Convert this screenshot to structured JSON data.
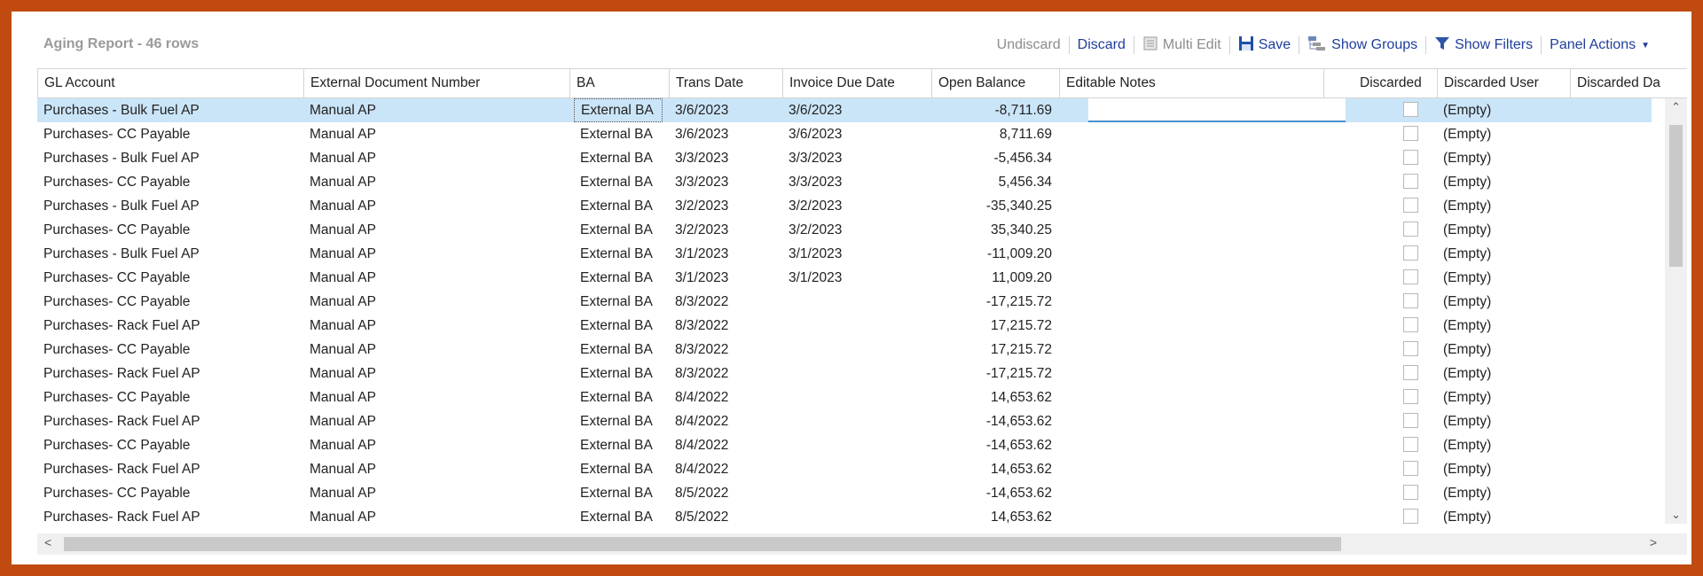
{
  "report_title": "Aging Report - 46 rows",
  "toolbar": {
    "undiscard": "Undiscard",
    "discard": "Discard",
    "multi_edit": "Multi Edit",
    "save": "Save",
    "show_groups": "Show Groups",
    "show_filters": "Show Filters",
    "panel_actions": "Panel Actions"
  },
  "columns": [
    "GL Account",
    "External Document Number",
    "BA",
    "Trans Date",
    "Invoice Due Date",
    "Open Balance",
    "Editable Notes",
    "Discarded",
    "Discarded User",
    "Discarded Da"
  ],
  "rows": [
    {
      "gl": "Purchases - Bulk Fuel AP",
      "doc": "Manual AP",
      "ba": "External BA",
      "trans": "3/6/2023",
      "due": "3/6/2023",
      "bal": "-8,711.69",
      "user": "(Empty)"
    },
    {
      "gl": "Purchases- CC Payable",
      "doc": "Manual AP",
      "ba": "External BA",
      "trans": "3/6/2023",
      "due": "3/6/2023",
      "bal": "8,711.69",
      "user": "(Empty)"
    },
    {
      "gl": "Purchases - Bulk Fuel AP",
      "doc": "Manual AP",
      "ba": "External BA",
      "trans": "3/3/2023",
      "due": "3/3/2023",
      "bal": "-5,456.34",
      "user": "(Empty)"
    },
    {
      "gl": "Purchases- CC Payable",
      "doc": "Manual AP",
      "ba": "External BA",
      "trans": "3/3/2023",
      "due": "3/3/2023",
      "bal": "5,456.34",
      "user": "(Empty)"
    },
    {
      "gl": "Purchases - Bulk Fuel AP",
      "doc": "Manual AP",
      "ba": "External BA",
      "trans": "3/2/2023",
      "due": "3/2/2023",
      "bal": "-35,340.25",
      "user": "(Empty)"
    },
    {
      "gl": "Purchases- CC Payable",
      "doc": "Manual AP",
      "ba": "External BA",
      "trans": "3/2/2023",
      "due": "3/2/2023",
      "bal": "35,340.25",
      "user": "(Empty)"
    },
    {
      "gl": "Purchases - Bulk Fuel AP",
      "doc": "Manual AP",
      "ba": "External BA",
      "trans": "3/1/2023",
      "due": "3/1/2023",
      "bal": "-11,009.20",
      "user": "(Empty)"
    },
    {
      "gl": "Purchases- CC Payable",
      "doc": "Manual AP",
      "ba": "External BA",
      "trans": "3/1/2023",
      "due": "3/1/2023",
      "bal": "11,009.20",
      "user": "(Empty)"
    },
    {
      "gl": "Purchases- CC Payable",
      "doc": "Manual AP",
      "ba": "External BA",
      "trans": "8/3/2022",
      "due": "",
      "bal": "-17,215.72",
      "user": "(Empty)"
    },
    {
      "gl": "Purchases- Rack Fuel AP",
      "doc": "Manual AP",
      "ba": "External BA",
      "trans": "8/3/2022",
      "due": "",
      "bal": "17,215.72",
      "user": "(Empty)"
    },
    {
      "gl": "Purchases- CC Payable",
      "doc": "Manual AP",
      "ba": "External BA",
      "trans": "8/3/2022",
      "due": "",
      "bal": "17,215.72",
      "user": "(Empty)"
    },
    {
      "gl": "Purchases- Rack Fuel AP",
      "doc": "Manual AP",
      "ba": "External BA",
      "trans": "8/3/2022",
      "due": "",
      "bal": "-17,215.72",
      "user": "(Empty)"
    },
    {
      "gl": "Purchases- CC Payable",
      "doc": "Manual AP",
      "ba": "External BA",
      "trans": "8/4/2022",
      "due": "",
      "bal": "14,653.62",
      "user": "(Empty)"
    },
    {
      "gl": "Purchases- Rack Fuel AP",
      "doc": "Manual AP",
      "ba": "External BA",
      "trans": "8/4/2022",
      "due": "",
      "bal": "-14,653.62",
      "user": "(Empty)"
    },
    {
      "gl": "Purchases- CC Payable",
      "doc": "Manual AP",
      "ba": "External BA",
      "trans": "8/4/2022",
      "due": "",
      "bal": "-14,653.62",
      "user": "(Empty)"
    },
    {
      "gl": "Purchases- Rack Fuel AP",
      "doc": "Manual AP",
      "ba": "External BA",
      "trans": "8/4/2022",
      "due": "",
      "bal": "14,653.62",
      "user": "(Empty)"
    },
    {
      "gl": "Purchases- CC Payable",
      "doc": "Manual AP",
      "ba": "External BA",
      "trans": "8/5/2022",
      "due": "",
      "bal": "-14,653.62",
      "user": "(Empty)"
    },
    {
      "gl": "Purchases- Rack Fuel AP",
      "doc": "Manual AP",
      "ba": "External BA",
      "trans": "8/5/2022",
      "due": "",
      "bal": "14,653.62",
      "user": "(Empty)"
    }
  ],
  "icons": {
    "multi_edit": "multi-edit-icon",
    "save": "save-disk-icon",
    "show_groups": "show-groups-icon",
    "show_filters": "filter-funnel-icon",
    "panel_actions": "caret-down-icon"
  },
  "colors": {
    "frame_border": "#c14a10",
    "link_blue": "#1f3e9c",
    "selected_row": "#cbe5f8"
  }
}
